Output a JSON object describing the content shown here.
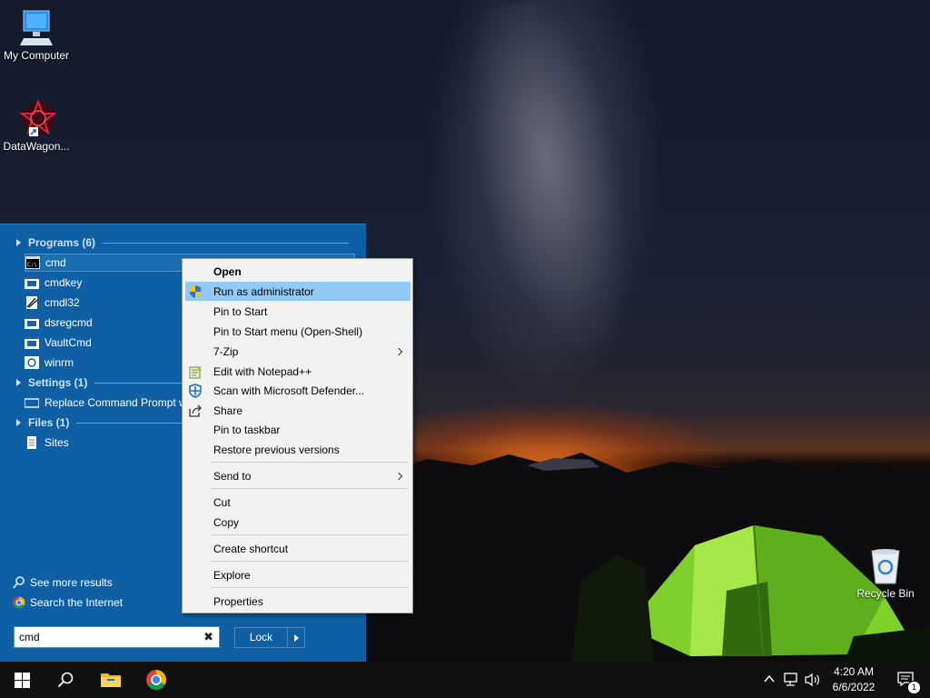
{
  "desktop": {
    "icons": [
      {
        "label": "My Computer",
        "icon": "computer-icon"
      },
      {
        "label": "DataWagon...",
        "icon": "datawagon-icon"
      },
      {
        "label": "Recycle Bin",
        "icon": "recycle-bin-icon"
      }
    ]
  },
  "start_menu": {
    "groups": [
      {
        "title": "Programs (6)"
      },
      {
        "title": "Settings (1)"
      },
      {
        "title": "Files (1)"
      }
    ],
    "programs": [
      {
        "label": "cmd",
        "icon": "cmd-icon"
      },
      {
        "label": "cmdkey",
        "icon": "app-window-icon"
      },
      {
        "label": "cmdl32",
        "icon": "cmdl32-icon"
      },
      {
        "label": "dsregcmd",
        "icon": "app-window-icon"
      },
      {
        "label": "VaultCmd",
        "icon": "app-window-icon"
      },
      {
        "label": "winrm",
        "icon": "app-window-icon"
      }
    ],
    "settings": [
      {
        "label": "Replace Command Prompt with Windows PowerShell",
        "icon": "settings-display-icon"
      }
    ],
    "files": [
      {
        "label": "Sites",
        "icon": "document-icon"
      }
    ],
    "see_more": "See more results",
    "search_internet": "Search the Internet",
    "search_value": "cmd",
    "lock_label": "Lock"
  },
  "context_menu": {
    "items": [
      {
        "label": "Open"
      },
      {
        "label": "Run as administrator",
        "icon": "uac-shield-icon"
      },
      {
        "label": "Pin to Start"
      },
      {
        "label": "Pin to Start menu (Open-Shell)"
      },
      {
        "label": "7-Zip"
      },
      {
        "label": "Edit with Notepad++",
        "icon": "notepadpp-icon"
      },
      {
        "label": "Scan with Microsoft Defender...",
        "icon": "defender-icon"
      },
      {
        "label": "Share",
        "icon": "share-icon"
      },
      {
        "label": "Pin to taskbar"
      },
      {
        "label": "Restore previous versions"
      },
      {
        "label": "Send to"
      },
      {
        "label": "Cut"
      },
      {
        "label": "Copy"
      },
      {
        "label": "Create shortcut"
      },
      {
        "label": "Explore"
      },
      {
        "label": "Properties"
      }
    ]
  },
  "taskbar": {
    "time": "4:20 AM",
    "date": "6/6/2022",
    "notification_count": "1"
  },
  "colors": {
    "start_menu_bg": "#0e5fa3",
    "highlight": "#91c9f7",
    "taskbar_bg": "#101010"
  }
}
